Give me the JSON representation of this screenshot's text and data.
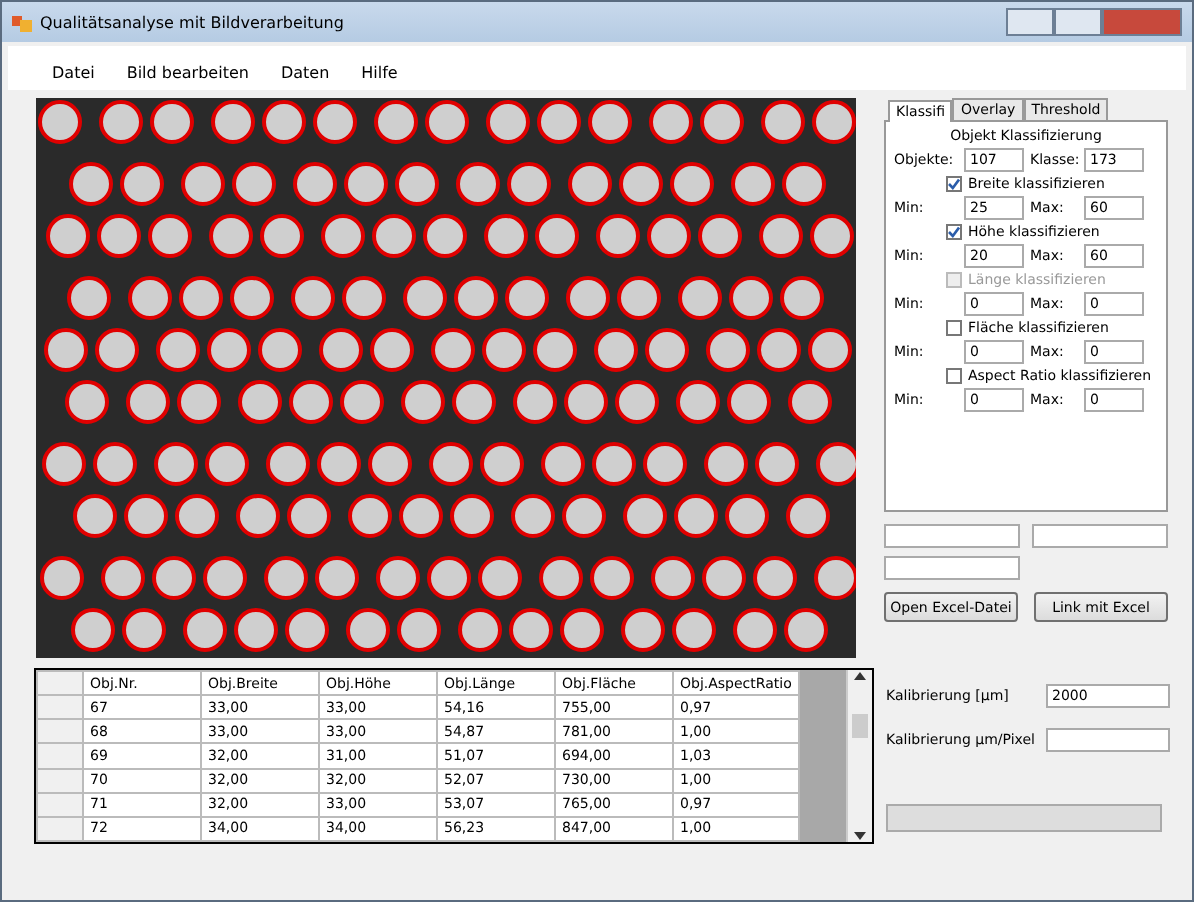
{
  "window": {
    "title": "Qualitätsanalyse mit Bildverarbeitung"
  },
  "menu": [
    "Datei",
    "Bild bearbeiten",
    "Daten",
    "Hilfe"
  ],
  "tabs": [
    {
      "label": "Klassifi",
      "selected": true
    },
    {
      "label": "Overlay",
      "selected": false
    },
    {
      "label": "Threshold",
      "selected": false
    }
  ],
  "classification": {
    "heading": "Objekt Klassifizierung",
    "objects_label": "Objekte:",
    "objects_value": "107",
    "class_label": "Klasse:",
    "class_value": "173",
    "groups": [
      {
        "label": "Breite klassifizieren",
        "checked": true,
        "disabled": false,
        "min_label": "Min:",
        "min": "25",
        "max_label": "Max:",
        "max": "60"
      },
      {
        "label": "Höhe klassifizieren",
        "checked": true,
        "disabled": false,
        "min_label": "Min:",
        "min": "20",
        "max_label": "Max:",
        "max": "60"
      },
      {
        "label": "Länge klassifizieren",
        "checked": false,
        "disabled": true,
        "min_label": "Min:",
        "min": "0",
        "max_label": "Max:",
        "max": "0"
      },
      {
        "label": "Fläche klassifizieren",
        "checked": false,
        "disabled": false,
        "min_label": "Min:",
        "min": "0",
        "max_label": "Max:",
        "max": "0"
      },
      {
        "label": "Aspect Ratio klassifizieren",
        "checked": false,
        "disabled": false,
        "min_label": "Min:",
        "min": "0",
        "max_label": "Max:",
        "max": "0"
      }
    ]
  },
  "buttons": [
    "Open Excel-Datei",
    "Link mit Excel"
  ],
  "table": {
    "columns": [
      "Obj.Nr.",
      "Obj.Breite",
      "Obj.Höhe",
      "Obj.Länge",
      "Obj.Fläche",
      "Obj.AspectRatio"
    ],
    "rows": [
      [
        "67",
        "33,00",
        "33,00",
        "54,16",
        "755,00",
        "0,97"
      ],
      [
        "68",
        "33,00",
        "33,00",
        "54,87",
        "781,00",
        "1,00"
      ],
      [
        "69",
        "32,00",
        "31,00",
        "51,07",
        "694,00",
        "1,03"
      ],
      [
        "70",
        "32,00",
        "32,00",
        "52,07",
        "730,00",
        "1,00"
      ],
      [
        "71",
        "32,00",
        "33,00",
        "53,07",
        "765,00",
        "0,97"
      ],
      [
        "72",
        "34,00",
        "34,00",
        "56,23",
        "847,00",
        "1,00"
      ]
    ]
  },
  "calibration": [
    {
      "label": "Kalibrierung [µm]",
      "value": "2000"
    },
    {
      "label": "Kalibrierung µm/Pixel"
    }
  ],
  "progress": {
    "level": 0
  }
}
